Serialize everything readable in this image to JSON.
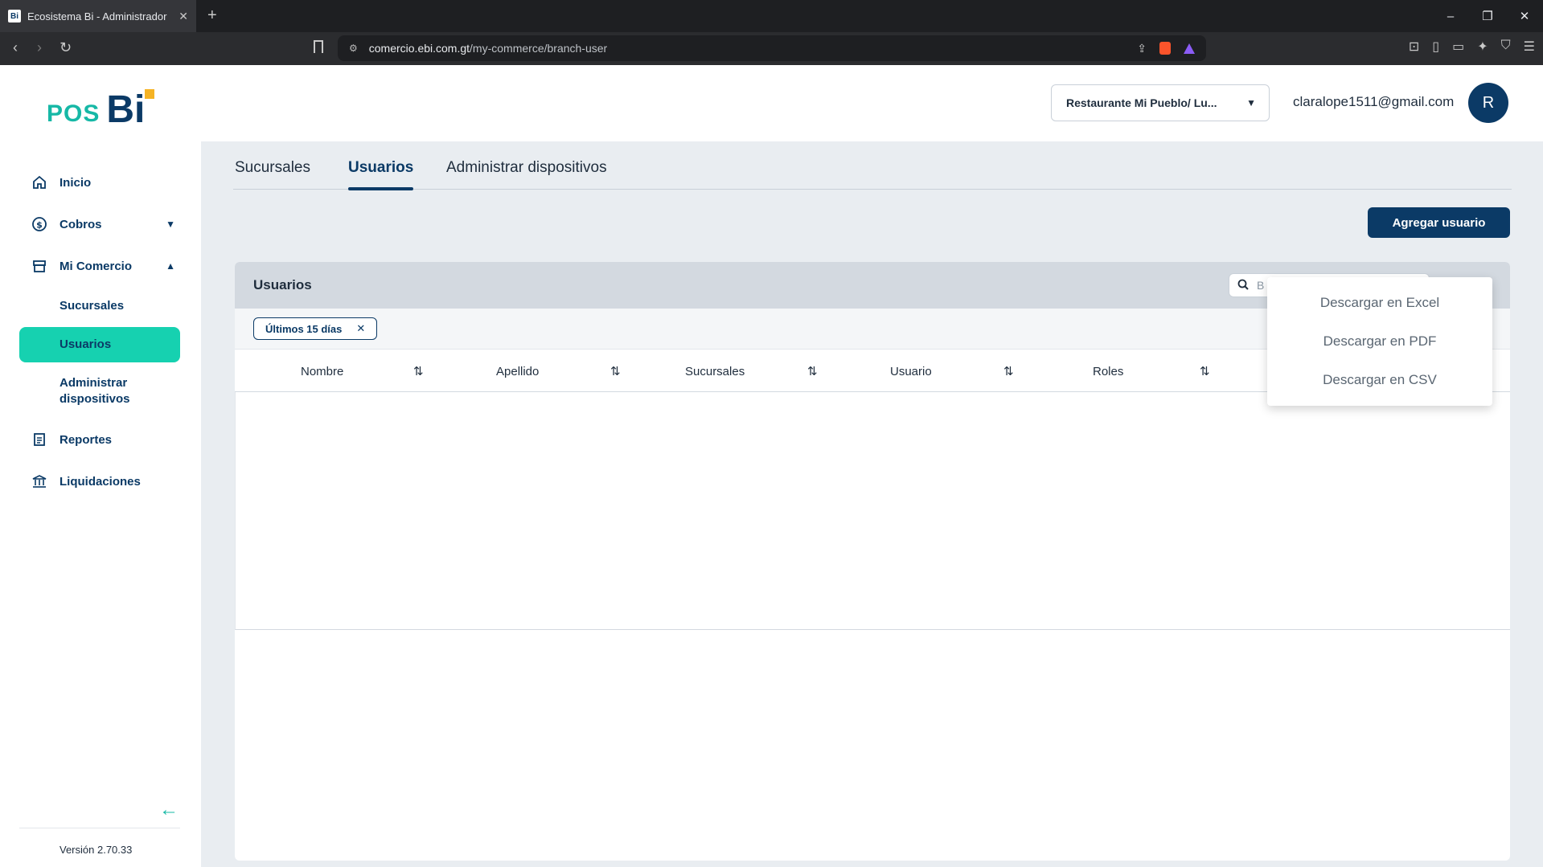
{
  "browser": {
    "tab_title": "Ecosistema Bi - Administrador",
    "favicon_text": "Bi",
    "url_host": "comercio.ebi.com.gt",
    "url_path": "/my-commerce/branch-user"
  },
  "brand": {
    "pos": "POS",
    "bi": "Bi"
  },
  "sidebar": {
    "items": [
      {
        "label": "Inicio",
        "icon": "home-icon"
      },
      {
        "label": "Cobros",
        "icon": "money-icon"
      },
      {
        "label": "Mi Comercio",
        "icon": "store-icon"
      },
      {
        "label": "Reportes",
        "icon": "report-icon"
      },
      {
        "label": "Liquidaciones",
        "icon": "bank-icon"
      }
    ],
    "sub_items": [
      "Sucursales",
      "Usuarios",
      "Administrar dispositivos"
    ],
    "version": "Versión 2.70.33"
  },
  "header": {
    "branch": "Restaurante Mi Pueblo/ Lu...",
    "email": "claralope1511@gmail.com",
    "avatar_initial": "R"
  },
  "tabs": [
    "Sucursales",
    "Usuarios",
    "Administrar dispositivos"
  ],
  "add_button": "Agregar usuario",
  "card": {
    "title": "Usuarios",
    "search_placeholder": "B",
    "filter_chip": "Últimos 15 días",
    "columns": [
      "Nombre",
      "Apellido",
      "Sucursales",
      "Usuario",
      "Roles"
    ]
  },
  "download_menu": [
    "Descargar en Excel",
    "Descargar en PDF",
    "Descargar en CSV"
  ],
  "colors": {
    "primary": "#0b3a66",
    "accent": "#16d1b0",
    "logo_accent": "#f5b324"
  }
}
